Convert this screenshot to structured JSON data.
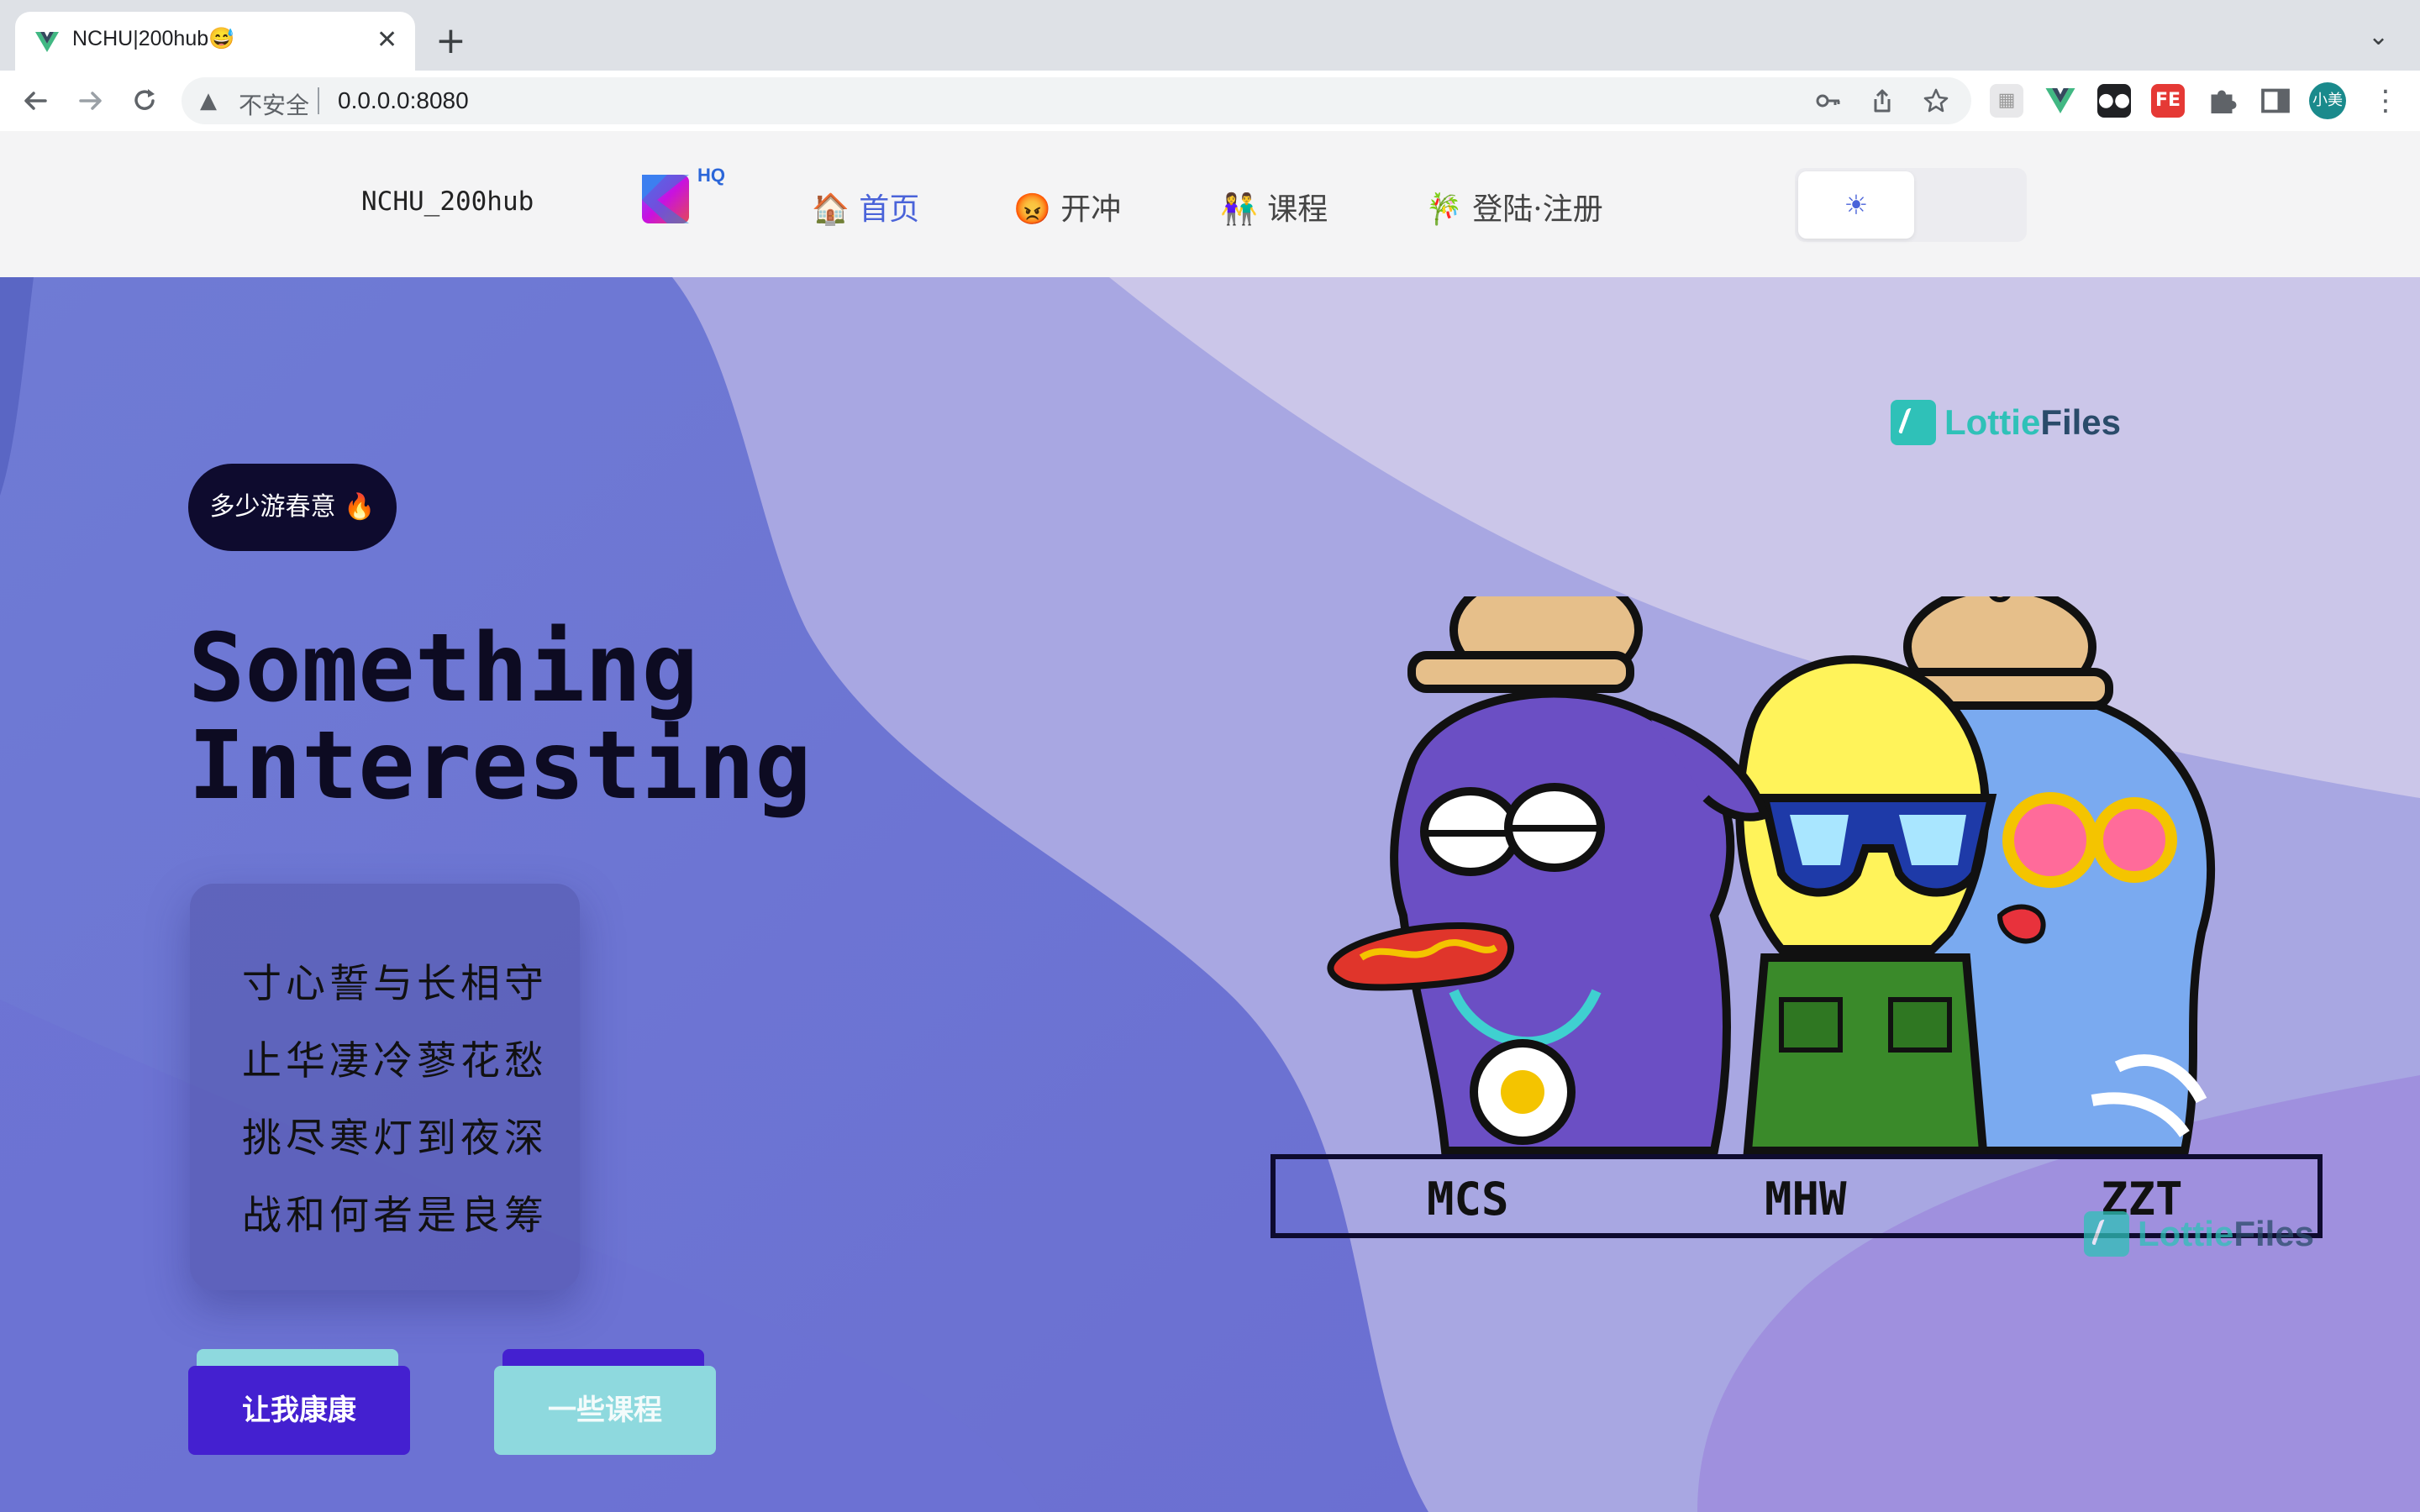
{
  "browser": {
    "tab_title": "NCHU|200hub😅",
    "tab_close": "✕",
    "new_tab": "+",
    "tab_menu": "⌄",
    "security_label": "不安全",
    "url": "0.0.0.0:8080",
    "profile_label": "小美",
    "nav_icons": [
      "back-arrow-icon",
      "forward-arrow-icon",
      "reload-icon"
    ],
    "omnibox_icons": [
      "key-icon",
      "share-icon",
      "star-icon"
    ],
    "extensions": [
      "ext-grid-icon",
      "vue-devtools-icon",
      "ext-tampermonkey-icon",
      "ext-fe-icon",
      "puzzle-icon",
      "side-panel-icon"
    ],
    "fe_label": "FE"
  },
  "header": {
    "brand": "NCHU_200hub",
    "logo_badge": "HQ",
    "nav": [
      {
        "label": "🏠 首页",
        "active": true
      },
      {
        "label": "😡 开冲",
        "active": false
      },
      {
        "label": "👫 课程",
        "active": false
      },
      {
        "label": "🎋 登陆·注册",
        "active": false
      }
    ],
    "theme_icon": "sun-icon",
    "theme_glyph": "☀"
  },
  "hero": {
    "badge": "多少游春意 🔥",
    "headline_line1": "Something",
    "headline_line2": "Interesting",
    "poem": [
      "寸心誓与长相守",
      "止华凄冷蓼花愁",
      "挑尽寒灯到夜深",
      "战和何者是良筹"
    ],
    "primary_button": "让我康康",
    "secondary_button": "一些课程",
    "lottie_lottie": "Lottie",
    "lottie_files": "Files",
    "names": [
      "MCS",
      "MHW",
      "ZZT"
    ]
  },
  "colors": {
    "accent": "#4a63d9",
    "primary_button": "#4420d0",
    "secondary_button": "#8ed9de",
    "hero_dark": "#0e0b2e",
    "lottie_teal": "#2fc1b8"
  }
}
